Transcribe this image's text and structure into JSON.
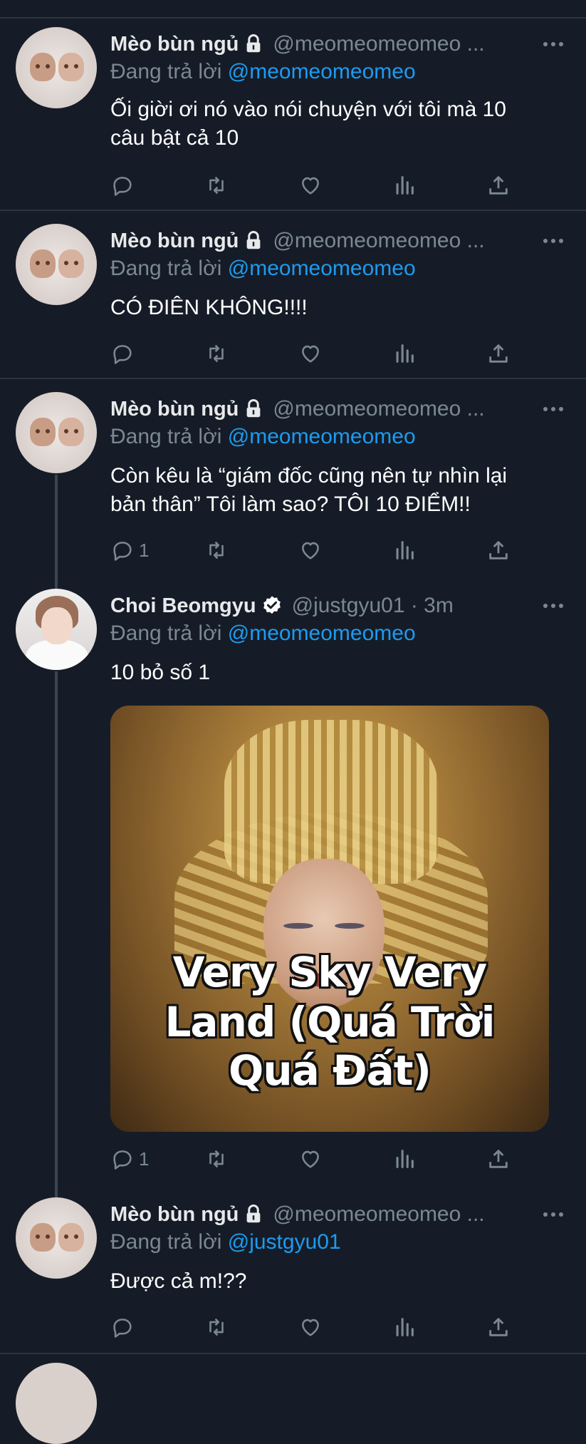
{
  "tweets": [
    {
      "name": "Mèo bùn ngủ",
      "handle": "@meomeomeomeo ...",
      "reply_prefix": "Đang trả lời",
      "reply_to": "@meomeomeomeo",
      "text_lines": [
        "Ối giời ơi nó vào nói chuyện với tôi mà 10",
        "câu bật cả 10"
      ],
      "reply_count": "",
      "protected": true
    },
    {
      "name": "Mèo bùn ngủ",
      "handle": "@meomeomeomeo ...",
      "reply_prefix": "Đang trả lời",
      "reply_to": "@meomeomeomeo",
      "text_lines": [
        "CÓ ĐIÊN KHÔNG!!!!"
      ],
      "reply_count": "",
      "protected": true
    },
    {
      "name": "Mèo bùn ngủ",
      "handle": "@meomeomeomeo ...",
      "reply_prefix": "Đang trả lời",
      "reply_to": "@meomeomeomeo",
      "text_lines": [
        "Còn kêu là “giám đốc cũng nên tự nhìn lại",
        "bản thân” Tôi làm sao? TÔI 10 ĐIỂM!!"
      ],
      "reply_count": "1",
      "protected": true
    },
    {
      "name": "Choi Beomgyu",
      "handle": "@justgyu01 · 3m",
      "reply_prefix": "Đang trả lời",
      "reply_to": "@meomeomeomeo",
      "text_lines": [
        "10 bỏ số 1"
      ],
      "reply_count": "1",
      "verified": true,
      "media_caption": [
        "Very Sky Very",
        "Land (Quá Trời",
        "Quá Đất)"
      ]
    },
    {
      "name": "Mèo bùn ngủ",
      "handle": "@meomeomeomeo ...",
      "reply_prefix": "Đang trả lời",
      "reply_to": "@justgyu01",
      "text_lines": [
        "Được cả m!??"
      ],
      "reply_count": "",
      "protected": true
    }
  ],
  "icons": {
    "reply": "reply-icon",
    "retweet": "retweet-icon",
    "like": "heart-icon",
    "views": "bar-chart-icon",
    "share": "share-icon",
    "more": "more-icon",
    "lock": "lock-icon",
    "verified": "verified-badge-icon"
  },
  "colors": {
    "background": "#151c27",
    "link": "#1d9bf0",
    "secondary": "#7b8894",
    "divider": "#2b3440"
  }
}
